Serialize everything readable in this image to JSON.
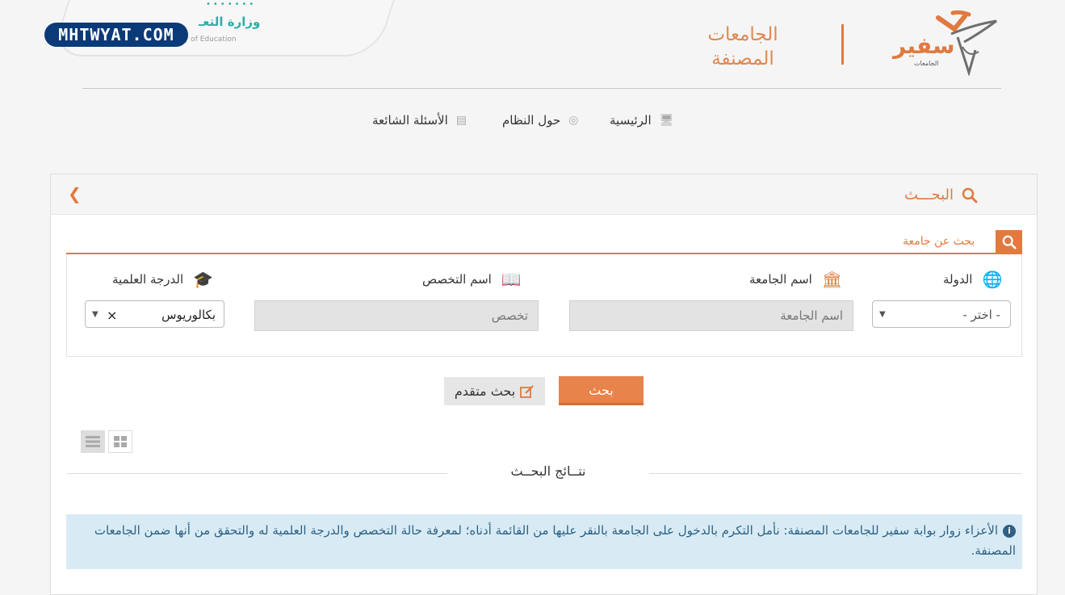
{
  "header": {
    "ministry_name_ar": "وزارة التعـ",
    "ministry_name_en": "y of Education",
    "watermark": "MHTWYAT.COM",
    "portal_title_line1": "الجامعات",
    "portal_title_line2": "المصنفة",
    "logo_text": "سفير",
    "logo_subtext": "الجامعات"
  },
  "nav": {
    "items": [
      {
        "label": "الرئيسية",
        "icon": "monitor-icon"
      },
      {
        "label": "حول النظام",
        "icon": "compass-icon"
      },
      {
        "label": "الأسئلة الشائعة",
        "icon": "document-icon"
      }
    ]
  },
  "panel": {
    "title": "البحـــث",
    "tab_label": "بحث عن جامعة"
  },
  "fields": {
    "country_label": "الدولة",
    "country_value": "- اختر -",
    "university_label": "اسم الجامعة",
    "university_placeholder": "اسم الجامعة",
    "specialty_label": "اسم التخصص",
    "specialty_placeholder": "تخصص",
    "degree_label": "الدرجة العلمية",
    "degree_value": "بكالوريوس",
    "degree_clear": "×"
  },
  "buttons": {
    "search": "بحث",
    "advanced": "بحث متقدم"
  },
  "results": {
    "title": "نتــائج البحــث",
    "notice": "الأعزاء زوار بوابة سفير للجامعات المصنفة: نأمل التكرم بالدخول على الجامعة بالنقر عليها من القائمة أدناه؛ لمعرفة حالة التخصص والدرجة العلمية له والتحقق من أنها ضمن الجامعات المصنفة."
  },
  "colors": {
    "accent": "#e07a3f",
    "notice_bg": "#d8ebf5",
    "notice_text": "#2e6183",
    "ministry_teal": "#2bb0a8"
  }
}
